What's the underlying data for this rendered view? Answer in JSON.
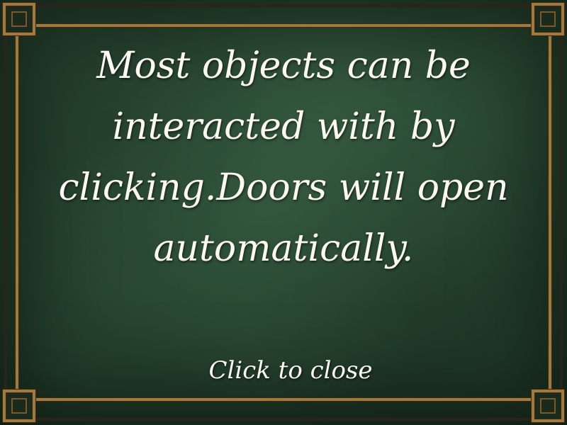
{
  "dialog": {
    "message": "Most objects can be interacted with by clicking.Doors will open automatically.",
    "close_label": "Click to close"
  },
  "colors": {
    "background": "#284731",
    "frame_gold": "#a0793f",
    "text": "#fbf8f0"
  }
}
